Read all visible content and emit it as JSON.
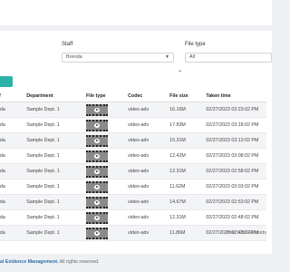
{
  "filters": {
    "staff": {
      "label": "Staff",
      "value": "Brenda"
    },
    "file_type": {
      "label": "File type",
      "value": "All"
    }
  },
  "table": {
    "columns": [
      "off",
      "Department",
      "File type",
      "Codec",
      "File size",
      "Taken time"
    ],
    "rows": [
      {
        "staff": "enda",
        "department": "Sample Dept. 1",
        "codec": "video-adv",
        "size": "16.16M",
        "taken": "02/27/2023 03:23:02 PM"
      },
      {
        "staff": "enda",
        "department": "Sample Dept. 1",
        "codec": "video-adv",
        "size": "17.83M",
        "taken": "02/27/2023 03:18:02 PM"
      },
      {
        "staff": "enda",
        "department": "Sample Dept. 1",
        "codec": "video-adv",
        "size": "15.31M",
        "taken": "02/27/2023 03:13:02 PM"
      },
      {
        "staff": "enda",
        "department": "Sample Dept. 1",
        "codec": "video-adv",
        "size": "12.42M",
        "taken": "02/27/2023 03:08:02 PM"
      },
      {
        "staff": "enda",
        "department": "Sample Dept. 1",
        "codec": "video-adv",
        "size": "12.31M",
        "taken": "02/27/2023 02:58:02 PM"
      },
      {
        "staff": "enda",
        "department": "Sample Dept. 1",
        "codec": "video-adv",
        "size": "11.62M",
        "taken": "02/27/2023 03:03:02 PM"
      },
      {
        "staff": "enda",
        "department": "Sample Dept. 1",
        "codec": "video-adv",
        "size": "14.67M",
        "taken": "02/27/2023 02:53:02 PM"
      },
      {
        "staff": "enda",
        "department": "Sample Dept. 1",
        "codec": "video-adv",
        "size": "12.31M",
        "taken": "02/27/2023 02:48:02 PM"
      },
      {
        "staff": "enda",
        "department": "Sample Dept. 1",
        "codec": "video-adv",
        "size": "11.86M",
        "taken": "02/27/2023 02:43:02 PM"
      }
    ],
    "total": "Total 1050 Records"
  },
  "footer": {
    "brand": "al Evidence Management.",
    "rights": " All rights reserved."
  }
}
